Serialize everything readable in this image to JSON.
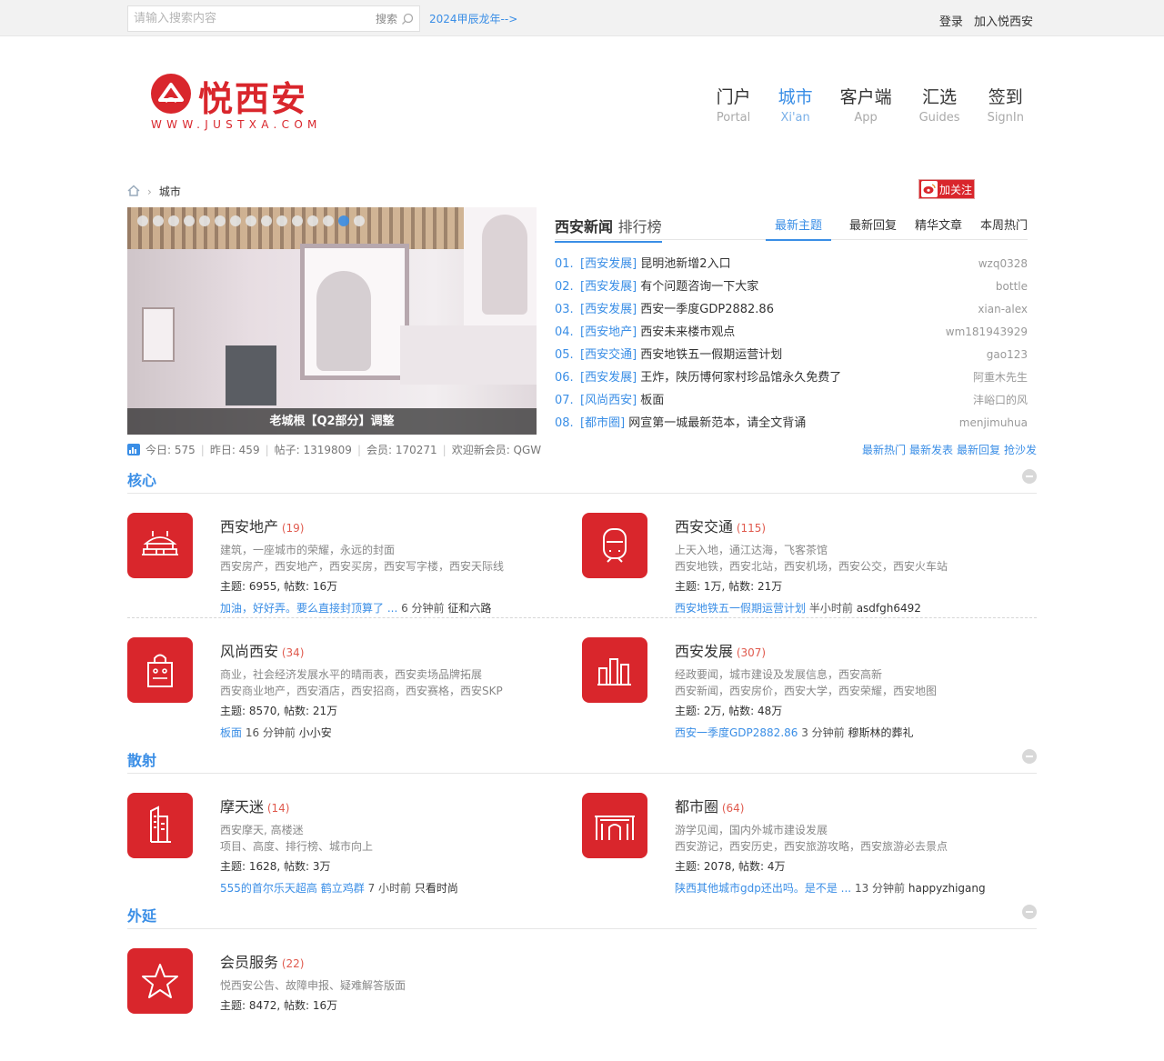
{
  "topbar": {
    "search_placeholder": "请输入搜索内容",
    "search_button": "搜索",
    "dragon_link": "2024甲辰龙年-->",
    "login": "登录",
    "join": "加入悦西安"
  },
  "header": {
    "logo_name": "悦西安",
    "logo_url": "WWW.JUSTXA.COM",
    "nav": [
      {
        "zh": "门户",
        "en": "Portal",
        "active": false
      },
      {
        "zh": "城市",
        "en": "Xi'an",
        "active": true
      },
      {
        "zh": "客户端",
        "en": "App",
        "active": false
      },
      {
        "zh": "汇选",
        "en": "Guides",
        "active": false
      },
      {
        "zh": "签到",
        "en": "SignIn",
        "active": false
      }
    ]
  },
  "breadcrumb": {
    "current": "城市",
    "follow": "加关注"
  },
  "slider": {
    "caption": "老城根【Q2部分】调整",
    "dot_count": 15,
    "active_dot": 13
  },
  "news": {
    "title": "西安新闻",
    "subtitle": "排行榜",
    "tabs": [
      "最新主题",
      "最新回复",
      "精华文章",
      "本周热门"
    ],
    "items": [
      {
        "num": "01.",
        "cat": "[西安发展]",
        "title": "昆明池新增2入口",
        "user": "wzq0328"
      },
      {
        "num": "02.",
        "cat": "[西安发展]",
        "title": "有个问题咨询一下大家",
        "user": "bottle"
      },
      {
        "num": "03.",
        "cat": "[西安发展]",
        "title": "西安一季度GDP2882.86",
        "user": "xian-alex"
      },
      {
        "num": "04.",
        "cat": "[西安地产]",
        "title": "西安未来楼市观点",
        "user": "wm181943929"
      },
      {
        "num": "05.",
        "cat": "[西安交通]",
        "title": "西安地铁五一假期运营计划",
        "user": "gao123"
      },
      {
        "num": "06.",
        "cat": "[西安发展]",
        "title": "王炸，陕历博何家村珍品馆永久免费了",
        "user": "阿重木先生"
      },
      {
        "num": "07.",
        "cat": "[风尚西安]",
        "title": "板面",
        "user": "沣峪口的风"
      },
      {
        "num": "08.",
        "cat": "[都市圈]",
        "title": "网宣第一城最新范本，请全文背诵",
        "user": "menjimuhua"
      }
    ]
  },
  "stats": {
    "today": "今日: 575",
    "yesterday": "昨日: 459",
    "posts": "帖子: 1319809",
    "members": "会员: 170271",
    "newest": "欢迎新会员: QGW",
    "links": [
      "最新热门",
      "最新发表",
      "最新回复",
      "抢沙发"
    ]
  },
  "sections": [
    {
      "title": "核心",
      "rows": [
        [
          {
            "icon": "stadium-icon",
            "name": "西安地产",
            "count": "(19)",
            "desc1": "建筑，一座城市的荣耀，永远的封面",
            "desc2": "西安房产，西安地产，西安买房，西安写字楼，西安天际线",
            "stat": "主题: 6955, 帖数: 16万",
            "last_title": "加油，好好弄。要么直接封顶算了 ...",
            "last_time": "6 分钟前",
            "last_user": "征和六路"
          },
          {
            "icon": "metro-train-icon",
            "name": "西安交通",
            "count": "(115)",
            "desc1": "上天入地，通江达海，飞客茶馆",
            "desc2": "西安地铁，西安北站，西安机场，西安公交，西安火车站",
            "stat": "主题: 1万, 帖数: 21万",
            "last_title": "西安地铁五一假期运营计划",
            "last_time": "半小时前",
            "last_user": "asdfgh6492"
          }
        ],
        [
          {
            "icon": "shopping-bag-icon",
            "name": "风尚西安",
            "count": "(34)",
            "desc1": "商业，社会经济发展水平的晴雨表，西安卖场品牌拓展",
            "desc2": "西安商业地产，西安酒店，西安招商，西安赛格，西安SKP",
            "stat": "主题: 8570, 帖数: 21万",
            "last_title": "板面",
            "last_time": "16 分钟前",
            "last_user": "小小安"
          },
          {
            "icon": "bar-chart-icon",
            "name": "西安发展",
            "count": "(307)",
            "desc1": "经政要闻，城市建设及发展信息，西安高新",
            "desc2": "西安新闻，西安房价，西安大学，西安荣耀，西安地图",
            "stat": "主题: 2万, 帖数: 48万",
            "last_title": "西安一季度GDP2882.86",
            "last_time": "3 分钟前",
            "last_user": "穆斯林的葬礼"
          }
        ]
      ]
    },
    {
      "title": "散射",
      "rows": [
        [
          {
            "icon": "skyscraper-icon",
            "name": "摩天迷",
            "count": "(14)",
            "desc1": "西安摩天, 高楼迷",
            "desc2": "项目、高度、排行榜、城市向上",
            "stat": "主题: 1628, 帖数: 3万",
            "last_title": "555的首尔乐天超高 鹤立鸡群",
            "last_time": "7 小时前",
            "last_user": "只看时尚"
          },
          {
            "icon": "city-gate-icon",
            "name": "都市圈",
            "count": "(64)",
            "desc1": "游学见闻，国内外城市建设发展",
            "desc2": "西安游记，西安历史，西安旅游攻略，西安旅游必去景点",
            "stat": "主题: 2078, 帖数: 4万",
            "last_title": "陕西其他城市gdp还出吗。是不是 ...",
            "last_time": "13 分钟前",
            "last_user": "happyzhigang"
          }
        ]
      ]
    },
    {
      "title": "外延",
      "rows": [
        [
          {
            "icon": "star-icon",
            "name": "会员服务",
            "count": "(22)",
            "desc1": "悦西安公告、故障申报、疑难解答版面",
            "desc2": "",
            "stat": "主题: 8472, 帖数: 16万",
            "last_title": "",
            "last_time": "",
            "last_user": ""
          }
        ]
      ]
    }
  ],
  "colors": {
    "accent": "#3a8ee6",
    "brand_red": "#d9262c",
    "count_red": "#e05a4e"
  }
}
